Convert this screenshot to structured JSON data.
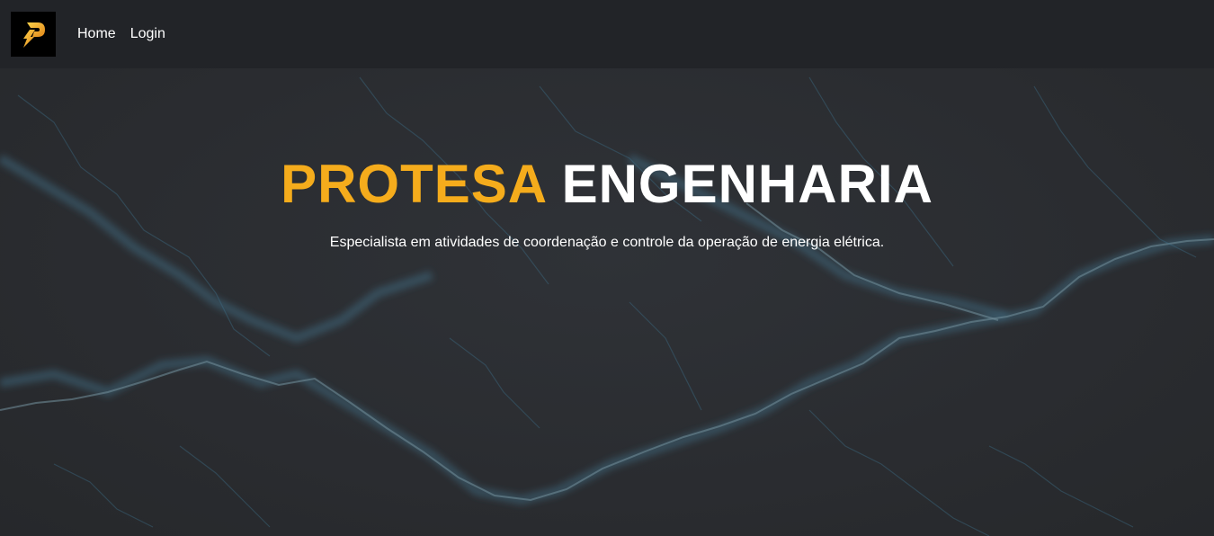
{
  "navbar": {
    "logo_icon": "protesa-logo-icon",
    "links": [
      {
        "label": "Home"
      },
      {
        "label": "Login"
      }
    ]
  },
  "hero": {
    "title_accent": "PROTESA",
    "title_main": "ENGENHARIA",
    "subtitle": "Especialista em atividades de coordenação e controle da operação de energia elétrica.",
    "background_image": "lightning-background",
    "colors": {
      "accent": "#f5ac1c",
      "title": "#ffffff",
      "navbar_bg": "#222428",
      "hero_bg": "#2b2d31"
    }
  }
}
